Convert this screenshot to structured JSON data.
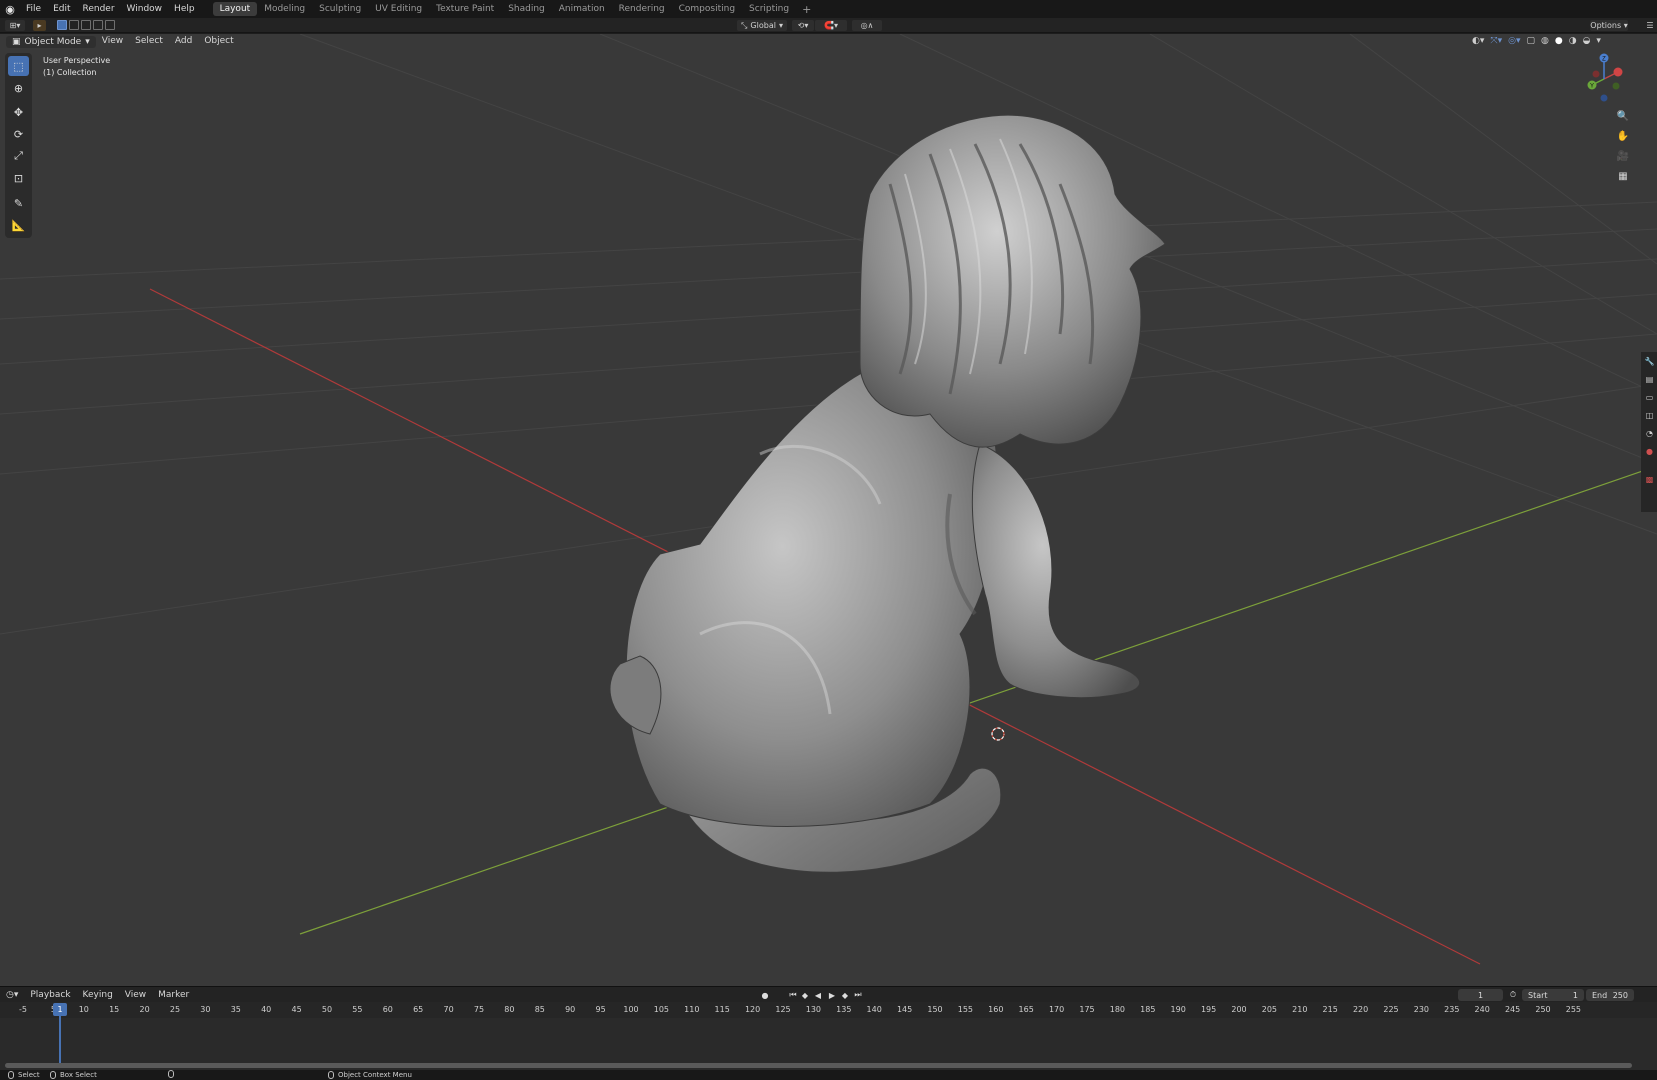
{
  "menu": {
    "items": [
      "File",
      "Edit",
      "Render",
      "Window",
      "Help"
    ]
  },
  "workspaces": {
    "tabs": [
      "Layout",
      "Modeling",
      "Sculpting",
      "UV Editing",
      "Texture Paint",
      "Shading",
      "Animation",
      "Rendering",
      "Compositing",
      "Scripting"
    ],
    "active": "Layout"
  },
  "toolbar2": {
    "orientation": "Global",
    "options_label": "Options"
  },
  "viewport_header": {
    "mode": "Object Mode",
    "menus": [
      "View",
      "Select",
      "Add",
      "Object"
    ]
  },
  "viewport": {
    "view_name": "User Perspective",
    "collection": "(1) Collection",
    "colors": {
      "background": "#393939",
      "grid": "#444444",
      "x_axis": "#b03a3a",
      "y_axis": "#7da03a",
      "mesh": "#a8a8a8"
    }
  },
  "timeline": {
    "menus": [
      "Playback",
      "Keying",
      "View",
      "Marker"
    ],
    "current_frame": "1",
    "start_label": "Start",
    "start_value": "1",
    "end_label": "End",
    "end_value": "250",
    "ruler": [
      "-5",
      "5",
      "10",
      "15",
      "20",
      "25",
      "30",
      "35",
      "40",
      "45",
      "50",
      "55",
      "60",
      "65",
      "70",
      "75",
      "80",
      "85",
      "90",
      "95",
      "100",
      "105",
      "110",
      "115",
      "120",
      "125",
      "130",
      "135",
      "140",
      "145",
      "150",
      "155",
      "160",
      "165",
      "170",
      "175",
      "180",
      "185",
      "190",
      "195",
      "200",
      "205",
      "210",
      "215",
      "220",
      "225",
      "230",
      "235",
      "240",
      "245",
      "250",
      "255"
    ]
  },
  "statusbar": {
    "select": "Select",
    "box_select": "Box Select",
    "context_menu": "Object Context Menu"
  }
}
